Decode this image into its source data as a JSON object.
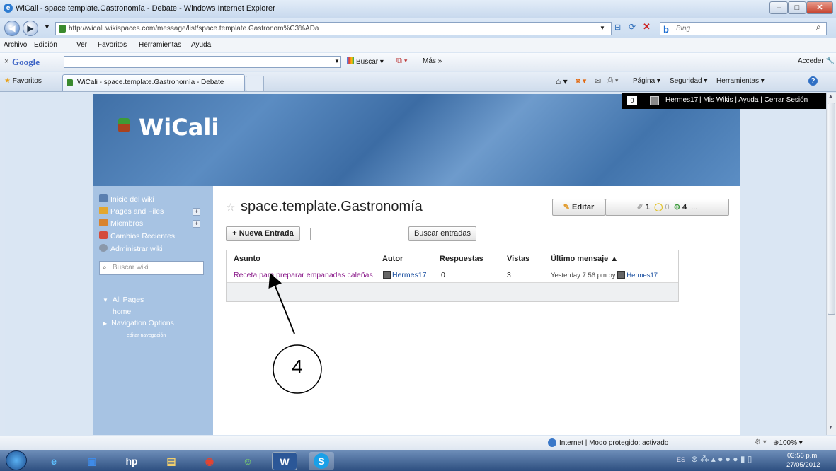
{
  "window": {
    "title": "WiCali - space.template.Gastronomía - Debate - Windows Internet Explorer",
    "url": "http://wicali.wikispaces.com/message/list/space.template.Gastronom%C3%ADa",
    "url_domain": "wicali.wikispaces.com",
    "search_engine": "Bing"
  },
  "menu": [
    "Archivo",
    "Edición",
    "Ver",
    "Favoritos",
    "Herramientas",
    "Ayuda"
  ],
  "google_bar": {
    "label": "Google",
    "search_btn": "Buscar",
    "more": "Más »",
    "signin": "Acceder"
  },
  "fav_bar": {
    "favorites": "Favoritos",
    "tab_title": "WiCali - space.template.Gastronomía - Debate",
    "cmd_page": "Página",
    "cmd_security": "Seguridad",
    "cmd_tools": "Herramientas"
  },
  "userbar": {
    "count": "0",
    "user": "Hermes17",
    "links": "Mis Wikis | Ayuda | Cerrar Sesión"
  },
  "site": {
    "logo": "WiCali",
    "sidebar": [
      {
        "label": "Inicio del wiki",
        "expand": false
      },
      {
        "label": "Pages and Files",
        "expand": true
      },
      {
        "label": "Miembros",
        "expand": true
      },
      {
        "label": "Cambios Recientes",
        "expand": false
      },
      {
        "label": "Administrar wiki",
        "expand": false
      }
    ],
    "search_placeholder": "Buscar wiki",
    "nav": {
      "all_pages": "All Pages",
      "home": "home",
      "nav_options": "Navigation Options",
      "edit_nav": "editar navegación"
    }
  },
  "main": {
    "title": "space.template.Gastronomía",
    "edit_btn": "Editar",
    "stat1": "1",
    "stat2": "0",
    "stat3": "4",
    "more": "...",
    "new_entry": "+ Nueva Entrada",
    "search_btn": "Buscar entradas",
    "columns": [
      "Asunto",
      "Autor",
      "Respuestas",
      "Vistas",
      "Último mensaje ▲"
    ],
    "rows": [
      {
        "subject": "Receta para preparar empanadas caleñas",
        "author": "Hermes17",
        "replies": "0",
        "views": "3",
        "last": "Yesterday 7:56 pm",
        "by": "by",
        "last_user": "Hermes17"
      }
    ],
    "annotation": "4"
  },
  "status": {
    "zone": "Internet | Modo protegido: activado",
    "zoom": "100%"
  },
  "taskbar": {
    "lang": "ES",
    "time": "03:56 p.m.",
    "date": "27/05/2012"
  }
}
